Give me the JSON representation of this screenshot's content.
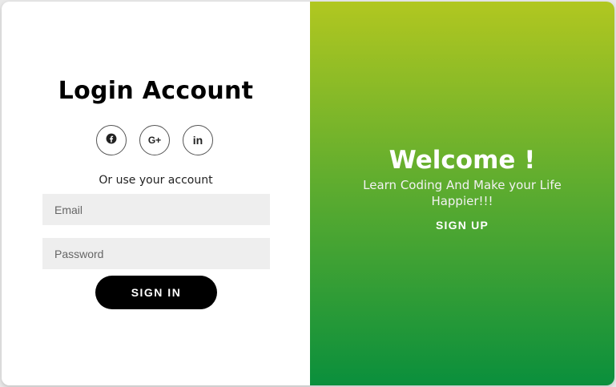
{
  "login": {
    "title": "Login Account",
    "social": [
      {
        "icon": "facebook-icon"
      },
      {
        "icon": "google-plus-icon",
        "glyph": "G+"
      },
      {
        "icon": "linkedin-icon",
        "glyph": "in"
      }
    ],
    "alt_text": "Or use your account",
    "email_placeholder": "Email",
    "password_placeholder": "Password",
    "signin_label": "SIGN IN"
  },
  "welcome": {
    "title": "Welcome !",
    "subtitle": "Learn Coding And Make your Life Happier!!!",
    "signup_label": "SIGN UP"
  },
  "colors": {
    "gradient_top": "#b1c720",
    "gradient_bottom": "#0a8f3c",
    "button_bg": "#000000",
    "input_bg": "#eeeeee"
  }
}
